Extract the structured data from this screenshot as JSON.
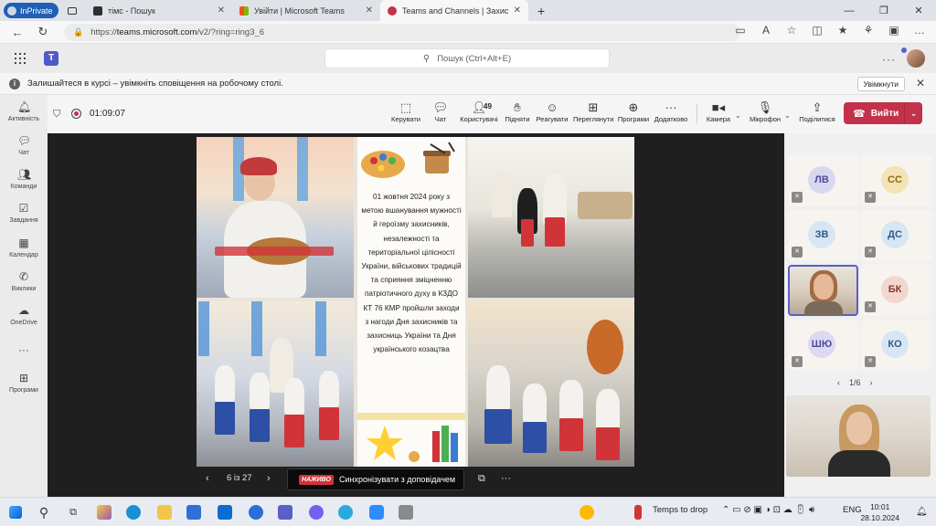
{
  "browser": {
    "inprivate_label": "InPrivate",
    "tabs": [
      {
        "label": "тімс - Пошук",
        "color": "#2f2f2f"
      },
      {
        "label": "Увійти | Microsoft Teams",
        "color": "#d83b01"
      },
      {
        "label": "Teams and Channels | Захис",
        "color": "#c4314b"
      }
    ],
    "new_tab": "+",
    "url_prefix": "https://",
    "url_host": "teams.microsoft.com",
    "url_path": "/v2/?ring=ring3_6"
  },
  "teams": {
    "search_placeholder": "Пошук (Ctrl+Alt+E)",
    "banner_text": "Залишайтеся в курсі – увімкніть сповіщення на робочому столі.",
    "banner_button": "Увімкнути",
    "rail": [
      {
        "label": "Активність",
        "icon": "bell-icon"
      },
      {
        "label": "Чат",
        "icon": "chat-icon"
      },
      {
        "label": "Команди",
        "icon": "teams-icon"
      },
      {
        "label": "Завдання",
        "icon": "tasks-icon"
      },
      {
        "label": "Календар",
        "icon": "calendar-icon"
      },
      {
        "label": "Виклики",
        "icon": "phone-icon"
      },
      {
        "label": "OneDrive",
        "icon": "cloud-icon"
      },
      {
        "label": "Програми",
        "icon": "apps-icon"
      }
    ],
    "timer": "01:09:07",
    "toolbar": {
      "raise": "Керувати",
      "chat": "Чат",
      "people": "Користувачі",
      "people_count": "49",
      "hand": "Підняти",
      "react": "Реагувати",
      "view": "Переглянути",
      "apps": "Програми",
      "more": "Додатково",
      "camera": "Камера",
      "mic": "Мікрофон",
      "share": "Поділитися",
      "leave": "Вийти"
    },
    "slide_text": "01 жовтня 2024 року з метою вшанування мужності й героїзму захисників, незалежності та територіальної цілісності України, військових традицій та сприяння зміцненню патріотичного духу в КЗДО КТ 76 КМР пройшли заходи з нагоди Дня захисників та захисниць України та Дня українського козацтва",
    "slide_pager": "6 із 27",
    "live_badge": "НАЖИВО",
    "sync_label": "Синхронізувати з доповідачем",
    "participants": [
      {
        "initials": "ЛВ",
        "bg": "#d9d7f0",
        "fg": "#4f4b9a"
      },
      {
        "initials": "СС",
        "bg": "#f3e3b5",
        "fg": "#8a6a10"
      },
      {
        "initials": "ЗВ",
        "bg": "#d8e6f3",
        "fg": "#2b5b8a"
      },
      {
        "initials": "ДС",
        "bg": "#d8e6f3",
        "fg": "#2b5b8a"
      },
      {
        "initials": "БК",
        "bg": "#f2d7cf",
        "fg": "#8a3b22"
      },
      {
        "initials": "ШЮ",
        "bg": "#ded9f3",
        "fg": "#4f4b9a"
      },
      {
        "initials": "КО",
        "bg": "#d8e6f3",
        "fg": "#2b5b8a"
      }
    ],
    "gallery_pager": "1/6"
  },
  "taskbar": {
    "weather": "Temps to drop",
    "lang": "ENG",
    "time": "10:01",
    "date": "28.10.2024"
  }
}
